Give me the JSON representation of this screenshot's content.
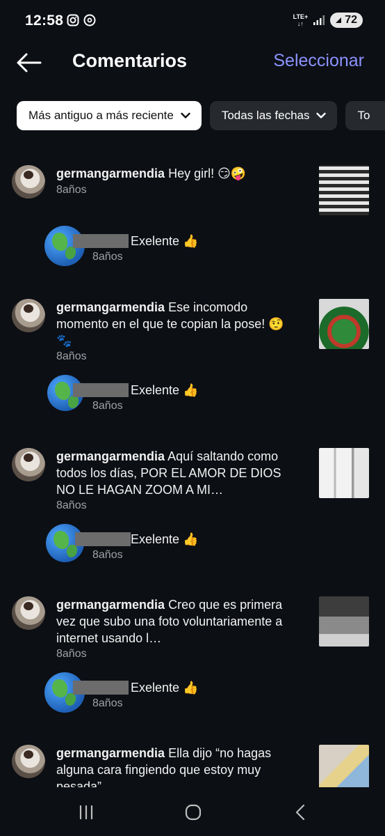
{
  "status_bar": {
    "time": "12:58",
    "network": "LTE+",
    "battery": "72"
  },
  "header": {
    "title": "Comentarios",
    "select_label": "Seleccionar"
  },
  "filters": [
    {
      "label": "Más antiguo a más reciente",
      "active": true
    },
    {
      "label": "Todas las fechas",
      "active": false
    },
    {
      "label": "To",
      "active": false
    }
  ],
  "comments": [
    {
      "username": "germangarmendia",
      "text": "Hey girl! 😏🤪",
      "age": "8años",
      "reply": {
        "text": "Exelente 👍",
        "age": "8años"
      }
    },
    {
      "username": "germangarmendia",
      "text": "Ese incomodo momento en el que te copian la pose! 🤨🐾",
      "age": "8años",
      "reply": {
        "text": "Exelente 👍",
        "age": "8años"
      }
    },
    {
      "username": "germangarmendia",
      "text": "Aquí saltando como todos los días, POR EL AMOR DE DIOS NO LE HAGAN ZOOM A MI…",
      "age": "8años",
      "reply": {
        "text": "Exelente 👍",
        "age": "8años"
      }
    },
    {
      "username": "germangarmendia",
      "text": "Creo que es primera vez que subo una foto voluntariamente a internet usando l…",
      "age": "8años",
      "reply": {
        "text": "Exelente 👍",
        "age": "8años"
      }
    },
    {
      "username": "germangarmendia",
      "text": "Ella dijo “no hagas alguna cara fingiendo que estoy muy pesada”",
      "age": "",
      "reply": null
    }
  ]
}
